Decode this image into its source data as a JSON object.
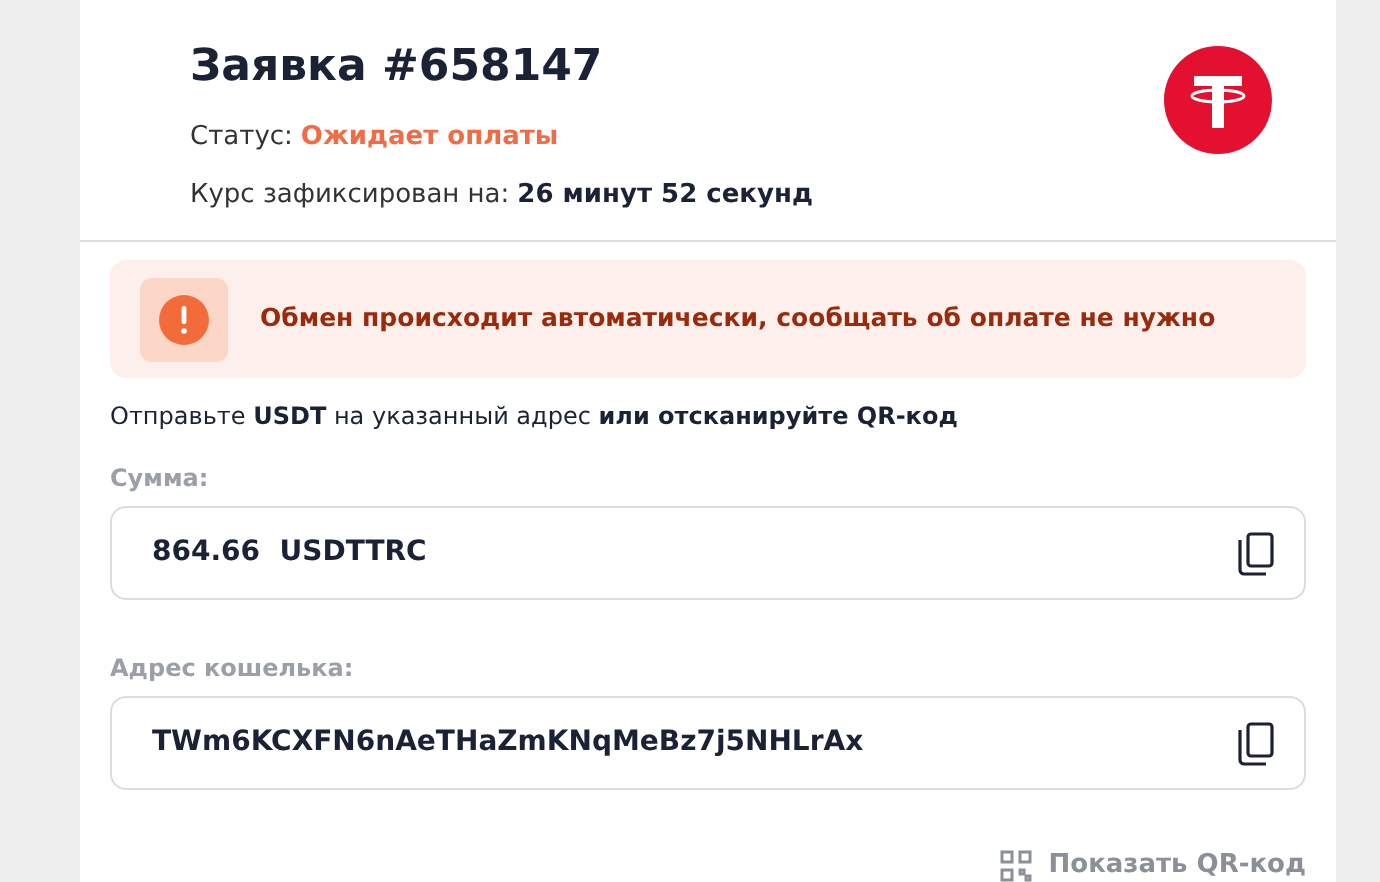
{
  "order": {
    "title": "Заявка #658147",
    "status_label": "Статус:",
    "status_value": "Ожидает оплаты",
    "rate_label": "Курс зафиксирован на:",
    "rate_value": "26 минут 52 секунд"
  },
  "notice": {
    "text": "Обмен происходит автоматически, сообщать об оплате не нужно"
  },
  "instruction": "Отправьте **USDT** на указанный адрес **или отсканируйте QR-код**",
  "fields": [
    {
      "label": "Сумма:",
      "value": "864.66  USDTTRC"
    },
    {
      "label": "Адрес кошелька:",
      "value": "TWm6KCXFN6nAeTHaZmKNqMeBz7j5NHLrAx"
    }
  ],
  "qr_button": "Показать QR-код"
}
